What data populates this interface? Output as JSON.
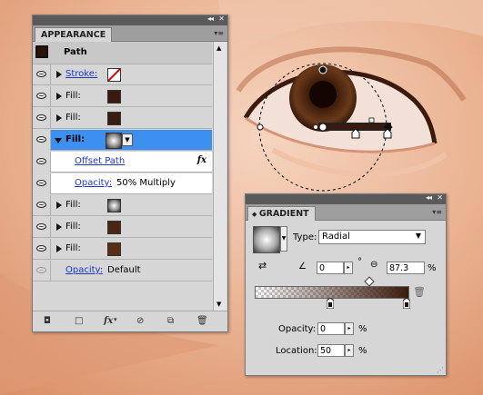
{
  "appearance": {
    "tab_label": "APPEARANCE",
    "object_type": "Path",
    "rows": [
      {
        "kind": "stroke",
        "label": "Stroke:"
      },
      {
        "kind": "fill",
        "label": "Fill:",
        "color": "#3a1a10"
      },
      {
        "kind": "fill",
        "label": "Fill:",
        "color": "#3a1d12"
      },
      {
        "kind": "fill-selected",
        "label": "Fill:"
      },
      {
        "kind": "effect",
        "label": "Offset Path",
        "fx": "fx"
      },
      {
        "kind": "opacity",
        "label": "Opacity:",
        "value": "50% Multiply"
      },
      {
        "kind": "fill",
        "label": "Fill:"
      },
      {
        "kind": "fill",
        "label": "Fill:",
        "color": "#4a2613"
      },
      {
        "kind": "fill",
        "label": "Fill:",
        "color": "#5a2e12"
      },
      {
        "kind": "opacity-default",
        "label": "Opacity:",
        "value": "Default"
      }
    ],
    "bottom_fx": "fx"
  },
  "gradient": {
    "tab_label": "GRADIENT",
    "type_label": "Type:",
    "type_value": "Radial",
    "angle_value": "0",
    "degree_symbol": "°",
    "aspect_value": "87.3",
    "aspect_unit": "%",
    "opacity_label": "Opacity:",
    "opacity_value": "0",
    "opacity_unit": "%",
    "location_label": "Location:",
    "location_value": "50",
    "location_unit": "%"
  },
  "colors": {
    "selection_blue": "#3d8ff0",
    "link_blue": "#2036c8",
    "skin": "#e8b08d",
    "iris_dark": "#3a1a0c"
  },
  "icons": [
    "visibility-eye-icon",
    "fx-icon",
    "new-item-icon",
    "clear-icon",
    "delete-icon",
    "panel-menu-icon",
    "gradient-swatch-icon",
    "reverse-gradient-icon",
    "angle-icon",
    "aspect-ratio-icon",
    "trash-icon"
  ]
}
